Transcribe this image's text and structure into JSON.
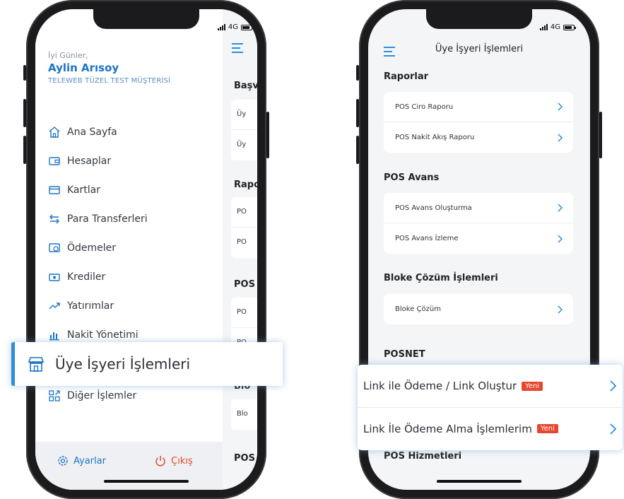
{
  "status": {
    "network": "4G"
  },
  "left": {
    "greeting": "İyi Günler,",
    "user_name": "Aylin Arısoy",
    "company": "TELEWEB TÜZEL TEST MÜŞTERİSİ",
    "menu": [
      {
        "label": "Ana Sayfa",
        "icon": "home-icon"
      },
      {
        "label": "Hesaplar",
        "icon": "wallet-icon"
      },
      {
        "label": "Kartlar",
        "icon": "card-icon"
      },
      {
        "label": "Para Transferleri",
        "icon": "transfer-icon"
      },
      {
        "label": "Ödemeler",
        "icon": "payment-icon"
      },
      {
        "label": "Krediler",
        "icon": "cash-icon"
      },
      {
        "label": "Yatırımlar",
        "icon": "trend-icon"
      },
      {
        "label": "Nakit Yönetimi",
        "icon": "chart-icon"
      },
      {
        "label": "Üye İşyeri İşlemleri",
        "icon": "store-icon"
      },
      {
        "label": "Diğer İşlemler",
        "icon": "grid-icon"
      }
    ],
    "settings": "Ayarlar",
    "logout": "Çıkış",
    "underlay": {
      "sections": [
        "Başv",
        "Rapo",
        "POS",
        "Blo",
        "POS"
      ],
      "rows": [
        "Üy",
        "Üy",
        "PO",
        "PO",
        "PO",
        "PO",
        "Blo"
      ]
    }
  },
  "callout_left": {
    "label": "Üye İşyeri İşlemleri"
  },
  "right": {
    "title": "Üye İşyeri İşlemleri",
    "sections": [
      {
        "title": "Raporlar",
        "items": [
          "POS Ciro Raporu",
          "POS Nakit Akış Raporu"
        ]
      },
      {
        "title": "POS Avans",
        "items": [
          "POS Avans Oluşturma",
          "POS Avans İzleme"
        ]
      },
      {
        "title": "Bloke Çözüm İşlemleri",
        "items": [
          "Bloke Çözüm"
        ]
      },
      {
        "title": "POSNET",
        "items": []
      },
      {
        "title": "POS Hizmetleri",
        "items": []
      }
    ]
  },
  "callout_right": {
    "items": [
      {
        "label": "Link ile Ödeme / Link Oluştur",
        "badge": "Yeni"
      },
      {
        "label": "Link İle Ödeme Alma İşlemlerim",
        "badge": "Yeni"
      }
    ]
  },
  "colors": {
    "accent": "#1a73c7",
    "badge": "#e8472d",
    "logout": "#e8472d"
  }
}
